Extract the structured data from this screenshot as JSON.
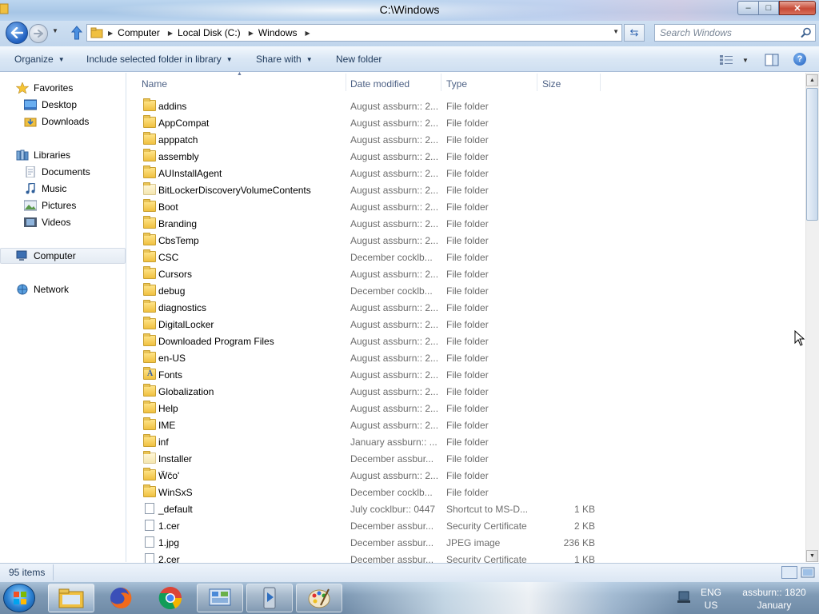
{
  "window": {
    "title": "C:\\Windows",
    "minimize_label": "–",
    "maximize_label": "□",
    "close_label": "✕"
  },
  "address": {
    "crumbs": [
      "Computer",
      "Local Disk (C:)",
      "Windows"
    ],
    "search_placeholder": "Search Windows"
  },
  "toolbar": {
    "organize": "Organize",
    "include_library": "Include selected folder in library",
    "share_with": "Share with",
    "new_folder": "New folder",
    "help": "?"
  },
  "nav": {
    "favorites": "Favorites",
    "desktop": "Desktop",
    "downloads": "Downloads",
    "libraries": "Libraries",
    "documents": "Documents",
    "music": "Music",
    "pictures": "Pictures",
    "videos": "Videos",
    "computer": "Computer",
    "network": "Network"
  },
  "columns": {
    "name": "Name",
    "date": "Date modified",
    "type": "Type",
    "size": "Size"
  },
  "files": [
    {
      "name": "addins",
      "date": "August assburn:: 2...",
      "type": "File folder",
      "size": "",
      "icon": "folder-icon"
    },
    {
      "name": "AppCompat",
      "date": "August assburn:: 2...",
      "type": "File folder",
      "size": "",
      "icon": "folder-icon"
    },
    {
      "name": "apppatch",
      "date": "August assburn:: 2...",
      "type": "File folder",
      "size": "",
      "icon": "folder-icon"
    },
    {
      "name": "assembly",
      "date": "August assburn:: 2...",
      "type": "File folder",
      "size": "",
      "icon": "folder-icon"
    },
    {
      "name": "AUInstallAgent",
      "date": "August assburn:: 2...",
      "type": "File folder",
      "size": "",
      "icon": "folder-icon"
    },
    {
      "name": "BitLockerDiscoveryVolumeContents",
      "date": "August assburn:: 2...",
      "type": "File folder",
      "size": "",
      "icon": "folder-light-icon"
    },
    {
      "name": "Boot",
      "date": "August assburn:: 2...",
      "type": "File folder",
      "size": "",
      "icon": "folder-icon"
    },
    {
      "name": "Branding",
      "date": "August assburn:: 2...",
      "type": "File folder",
      "size": "",
      "icon": "folder-icon"
    },
    {
      "name": "CbsTemp",
      "date": "August assburn:: 2...",
      "type": "File folder",
      "size": "",
      "icon": "folder-icon"
    },
    {
      "name": "CSC",
      "date": "December cocklb...",
      "type": "File folder",
      "size": "",
      "icon": "folder-icon"
    },
    {
      "name": "Cursors",
      "date": "August assburn:: 2...",
      "type": "File folder",
      "size": "",
      "icon": "folder-icon"
    },
    {
      "name": "debug",
      "date": "December cocklb...",
      "type": "File folder",
      "size": "",
      "icon": "folder-icon"
    },
    {
      "name": "diagnostics",
      "date": "August assburn:: 2...",
      "type": "File folder",
      "size": "",
      "icon": "folder-icon"
    },
    {
      "name": "DigitalLocker",
      "date": "August assburn:: 2...",
      "type": "File folder",
      "size": "",
      "icon": "folder-icon"
    },
    {
      "name": "Downloaded Program Files",
      "date": "August assburn:: 2...",
      "type": "File folder",
      "size": "",
      "icon": "folder-icon"
    },
    {
      "name": "en-US",
      "date": "August assburn:: 2...",
      "type": "File folder",
      "size": "",
      "icon": "folder-icon"
    },
    {
      "name": "Fonts",
      "date": "August assburn:: 2...",
      "type": "File folder",
      "size": "",
      "icon": "fonts-folder-icon"
    },
    {
      "name": "Globalization",
      "date": "August assburn:: 2...",
      "type": "File folder",
      "size": "",
      "icon": "folder-icon"
    },
    {
      "name": "Help",
      "date": "August assburn:: 2...",
      "type": "File folder",
      "size": "",
      "icon": "folder-icon"
    },
    {
      "name": "IME",
      "date": "August assburn:: 2...",
      "type": "File folder",
      "size": "",
      "icon": "folder-icon"
    },
    {
      "name": "inf",
      "date": "January assburn:: ...",
      "type": "File folder",
      "size": "",
      "icon": "folder-icon"
    },
    {
      "name": "Installer",
      "date": "December assbur...",
      "type": "File folder",
      "size": "",
      "icon": "folder-light-icon"
    },
    {
      "name": "Ẅc̈o'",
      "date": "August assburn:: 2...",
      "type": "File folder",
      "size": "",
      "icon": "folder-icon"
    },
    {
      "name": "WinSxS",
      "date": "December cocklb...",
      "type": "File folder",
      "size": "",
      "icon": "folder-icon"
    },
    {
      "name": "_default",
      "date": "July cocklbur:: 0447",
      "type": "Shortcut to MS-D...",
      "size": "1 KB",
      "icon": "file-icon"
    },
    {
      "name": "1.cer",
      "date": "December assbur...",
      "type": "Security Certificate",
      "size": "2 KB",
      "icon": "file-icon"
    },
    {
      "name": "1.jpg",
      "date": "December assbur...",
      "type": "JPEG image",
      "size": "236 KB",
      "icon": "file-icon"
    },
    {
      "name": "2.cer",
      "date": "December assbur...",
      "type": "Security Certificate",
      "size": "1 KB",
      "icon": "file-icon"
    }
  ],
  "status": {
    "item_count": "95 items"
  },
  "tray": {
    "lang_1": "ENG",
    "lang_2": "US",
    "time_1": "assburn:: 1820",
    "time_2": "January"
  }
}
